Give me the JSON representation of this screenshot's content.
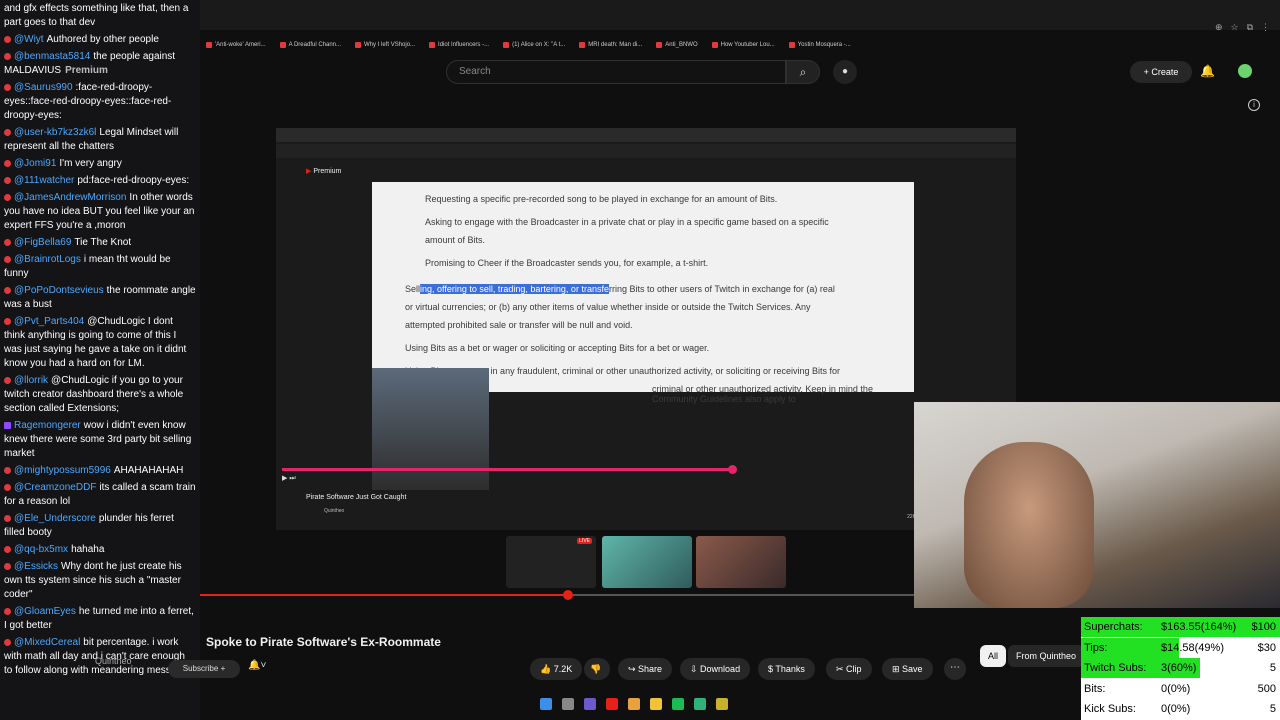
{
  "chat": [
    {
      "user": "",
      "text": "and gfx effects something like that, then a part goes to that dev",
      "platform": "yt"
    },
    {
      "user": "@Wiyt",
      "text": "Authored by other people",
      "platform": "yt"
    },
    {
      "user": "@benmasta5814",
      "text": "the people against MALDAVIUS",
      "platform": "yt",
      "badge": "Premium"
    },
    {
      "user": "@Saurus990",
      "text": ":face-red-droopy-eyes::face-red-droopy-eyes::face-red-droopy-eyes:",
      "platform": "yt"
    },
    {
      "user": "@user-kb7kz3zk6l",
      "text": "Legal Mindset will represent all the chatters",
      "platform": "yt"
    },
    {
      "user": "@Jomi91",
      "text": "I'm very angry",
      "platform": "yt"
    },
    {
      "user": "@111watcher",
      "text": "pd:face-red-droopy-eyes:",
      "platform": "yt"
    },
    {
      "user": "@JamesAndrewMorrison",
      "text": "In other words you have no idea BUT you feel like your an expert FFS you're a ,moron",
      "platform": "yt"
    },
    {
      "user": "@FigBella69",
      "text": "Tie The Knot",
      "platform": "yt"
    },
    {
      "user": "@BrainrotLogs",
      "text": "i mean tht would be funny",
      "platform": "yt"
    },
    {
      "user": "@PoPoDontsevieus",
      "text": "the roommate angle was a bust",
      "platform": "yt"
    },
    {
      "user": "@Pvt_Parts404",
      "text": "@ChudLogic I dont think anything is going to come of this I was just saying he gave a take on it didnt know you had a hard on for LM.",
      "platform": "yt"
    },
    {
      "user": "@llorrik",
      "text": "@ChudLogic if you go to your twitch creator dashboard there's a whole section called Extensions;",
      "platform": "yt"
    },
    {
      "user": "Ragemongerer",
      "text": "wow i didn't even know knew there were some 3rd party bit selling market",
      "platform": "tw"
    },
    {
      "user": "@mightypossum5996",
      "text": "AHAHAHAHAH",
      "platform": "yt"
    },
    {
      "user": "@CreamzoneDDF",
      "text": "its called a scam train for a reason lol",
      "platform": "yt"
    },
    {
      "user": "@Ele_Underscore",
      "text": "plunder his ferret filled booty",
      "platform": "yt"
    },
    {
      "user": "@qq-bx5mx",
      "text": "hahaha",
      "platform": "yt"
    },
    {
      "user": "@Essicks",
      "text": "Why dont he just create his own tts system since his such a \"master coder\"",
      "platform": "yt"
    },
    {
      "user": "@GloamEyes",
      "text": "he turned me into a ferret, I got better",
      "platform": "yt"
    },
    {
      "user": "@MixedCereal",
      "text": "bit percentage. i work with math all day and i can't care enough to follow along with meandering mess",
      "platform": "yt"
    }
  ],
  "bookmarks": [
    "'Anti-woke' Ameri...",
    "A Dreadful Chann...",
    "Why I left VShojo...",
    "Idiot Influencers -...",
    "(1) Alice on X: \"A t...",
    "MRI death: Man di...",
    "Anti_BNWO",
    "How Youtuber Lou...",
    "Yostin Mosquera -..."
  ],
  "header": {
    "search_placeholder": "Search",
    "create_label": "Create"
  },
  "embedded": {
    "inner_brand": "Premium",
    "doc_lines": [
      "Requesting a specific pre-recorded song to be played in exchange for an amount of Bits.",
      "Asking to engage with the Broadcaster in a private chat or play in a specific game based on a specific",
      "amount of Bits.",
      "Promising to Cheer if the Broadcaster sends you, for example, a t-shirt.",
      "Selling, offering to sell, trading, bartering, or transferring Bits to other users of Twitch in exchange for (a) real",
      "or virtual currencies; or (b) any other items of value whether inside or outside the Twitch Services. Any",
      "attempted prohibited sale or transfer will be null and void.",
      "Using Bits as a bet or wager or soliciting or accepting Bits for a bet or wager.",
      "Using Bits to engage in any fraudulent, criminal or other unauthorized activity, or soliciting or receiving Bits for",
      "criminal or other unauthorized activity.  Keep in mind the Community Guidelines also apply to"
    ],
    "hl_pre": "Sell",
    "hl_text": "ing, offering to sell, trading, bartering, or transfe",
    "hl_post": "rring Bits to other users of Twitch in exchange for (a) real",
    "video_title": "Pirate Software Just Got Caught",
    "channel": "Quintheo",
    "likes": "22K",
    "live_badge": "LIVE"
  },
  "video": {
    "title": "Spoke to Pirate Software's Ex-Roommate",
    "channel": "Quintheo",
    "subscribe_label": "Subscribe",
    "likes": "7.2K",
    "share": "Share",
    "download": "Download",
    "thanks": "Thanks",
    "clip": "Clip",
    "save": "Save"
  },
  "chips": {
    "all": "All",
    "from": "From Quintheo"
  },
  "stats": [
    {
      "label": "Superchats:",
      "value": "$163.55(164%)",
      "goal": "$100",
      "fraction": 1.0
    },
    {
      "label": "Tips:",
      "value": "$14.58(49%)",
      "goal": "$30",
      "fraction": 0.49
    },
    {
      "label": "Twitch Subs:",
      "value": "3(60%)",
      "goal": "5",
      "fraction": 0.6
    },
    {
      "label": "Bits:",
      "value": "0(0%)",
      "goal": "500",
      "fraction": 0.0
    },
    {
      "label": "Kick Subs:",
      "value": "0(0%)",
      "goal": "5",
      "fraction": 0.0
    }
  ],
  "colors": {
    "accent": "#e62117",
    "highlight": "#3b6ed8",
    "goal_bar": "#22e022"
  }
}
